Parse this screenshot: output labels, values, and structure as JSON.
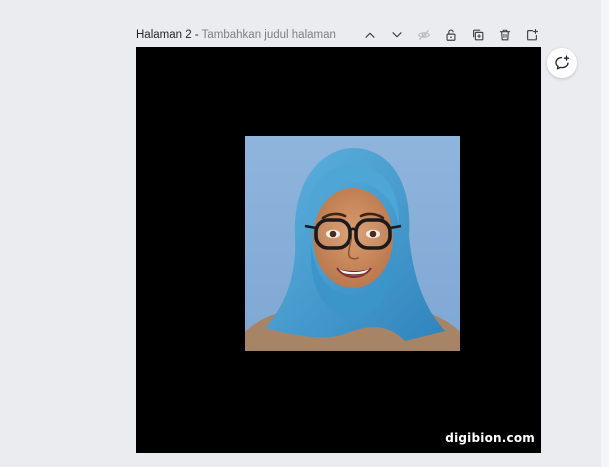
{
  "page_header": {
    "page_label": "Halaman 2",
    "separator": " - ",
    "title_placeholder": "Tambahkan judul halaman"
  },
  "toolbar": {
    "icons": [
      "chevron-up-icon",
      "chevron-down-icon",
      "eye-hidden-icon",
      "unlock-icon",
      "duplicate-icon",
      "trash-icon",
      "add-page-icon"
    ]
  },
  "canvas": {
    "background": "#000000",
    "image_subject": "avatar-illustration",
    "watermark": "digibion.com"
  },
  "side_actions": {
    "comment_icon": "add-comment-icon"
  }
}
